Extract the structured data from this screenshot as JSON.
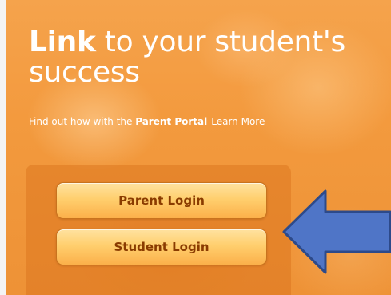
{
  "hero": {
    "headline_strong": "Link",
    "headline_rest": " to your student's success",
    "tagline_prefix": "Find out how with the ",
    "tagline_portal": "Parent Portal",
    "learn_more": "Learn More"
  },
  "login": {
    "parent_label": "Parent Login",
    "student_label": "Student Login"
  },
  "annotation": {
    "arrow_icon": "left-arrow-icon",
    "arrow_color": "#4f75c7",
    "arrow_outline": "#2d4a8a"
  },
  "colors": {
    "hero_orange": "#f39a3e",
    "button_top": "#ffe2a0",
    "button_bottom": "#fbb04a",
    "button_text": "#8a3b00"
  }
}
